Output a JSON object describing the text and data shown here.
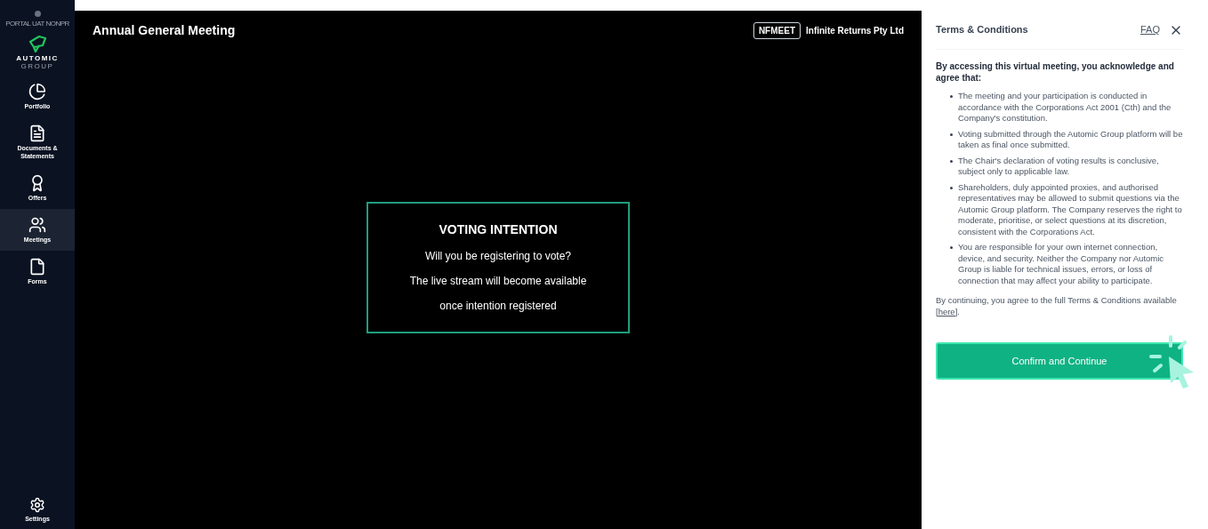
{
  "sidebar": {
    "environment": "PORTAL UAT NONPR",
    "logo_text": "AUTOMIC",
    "logo_subtext": "GROUP",
    "items": [
      {
        "label": "Portfolio",
        "selected": false
      },
      {
        "label": "Documents & Statements",
        "selected": false
      },
      {
        "label": "Offers",
        "selected": false
      },
      {
        "label": "Meetings",
        "selected": true
      },
      {
        "label": "Forms",
        "selected": false
      }
    ],
    "settings": {
      "label": "Settings"
    }
  },
  "header": {
    "title": "Annual General Meeting",
    "code_badge": "NFMEET",
    "company": "Infinite Returns Pty Ltd"
  },
  "voting_card": {
    "title": "VOTING INTENTION",
    "lines": [
      "Will you be registering to vote?",
      "The live stream will become available",
      "once intention registered"
    ]
  },
  "terms_panel": {
    "title": "Terms & Conditions",
    "faq_link": "FAQ",
    "intro": "By accessing this virtual meeting, you acknowledge and agree that:",
    "bullets": [
      "The meeting and your participation is conducted in accordance with the Corporations Act 2001 (Cth) and the Company's constitution.",
      "Voting submitted through the Automic Group platform will be taken as final once submitted.",
      "The Chair's declaration of voting results is conclusive, subject only to applicable law.",
      "Shareholders, duly appointed proxies, and authorised representatives may be allowed to submit questions via the Automic Group platform. The Company reserves the right to moderate, prioritise, or select questions at its discretion, consistent with the Corporations Act.",
      "You are responsible for your own internet connection, device, and security. Neither the Company nor Automic Group is liable for technical issues, errors, or loss of connection that may affect your ability to participate."
    ],
    "closing_text": "By continuing, you agree to the full Terms & Conditions available ",
    "closing_link": "[here]",
    "closing_end": ".",
    "confirm_button": "Confirm and Continue"
  }
}
